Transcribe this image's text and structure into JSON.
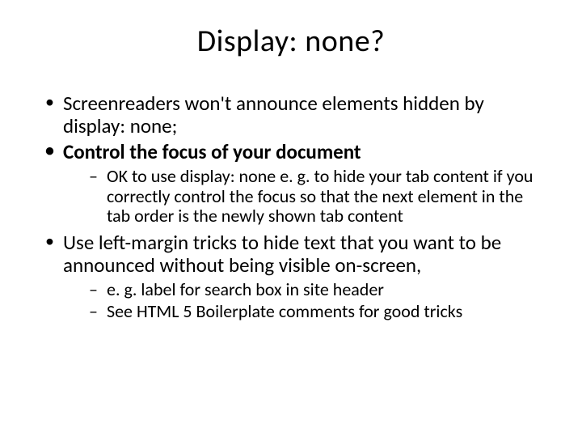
{
  "slide": {
    "title": "Display: none?",
    "bullets": [
      {
        "text": "Screenreaders won't announce elements hidden by display: none;",
        "bold": false,
        "sub": []
      },
      {
        "text": "Control the focus of your document",
        "bold": true,
        "sub": [
          "OK to use display: none e. g. to hide your tab content if you correctly control the focus so that the next element in the tab order is the newly shown tab content"
        ]
      },
      {
        "text": "Use left-margin tricks to hide text that you want to be announced without being visible on-screen,",
        "bold": false,
        "sub": [
          "e. g. label for search box in site header",
          "See HTML 5 Boilerplate comments for good tricks"
        ]
      }
    ]
  }
}
